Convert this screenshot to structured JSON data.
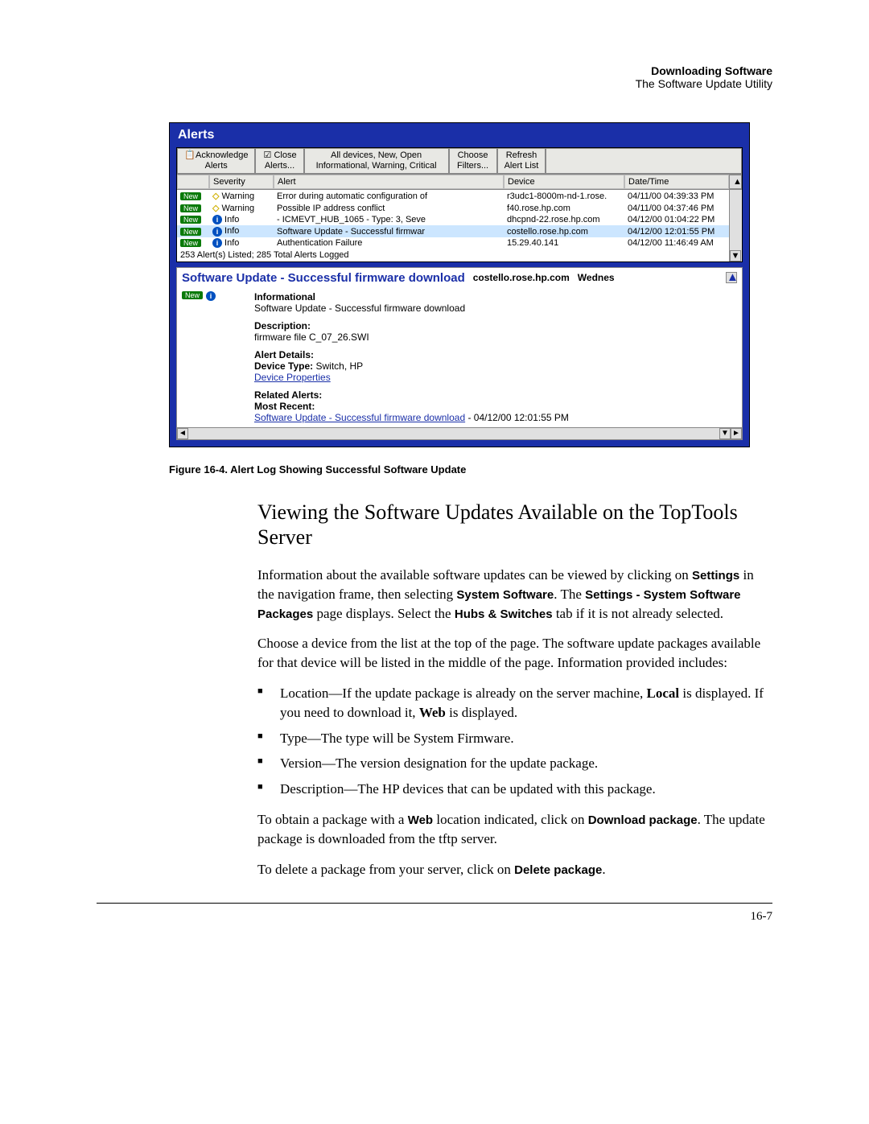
{
  "header": {
    "title_bold": "Downloading Software",
    "subtitle": "The Software Update Utility"
  },
  "window": {
    "title": "Alerts",
    "toolbar": {
      "ack": "Acknowledge",
      "ack2": "Alerts",
      "close": "Close",
      "close2": "Alerts...",
      "filter_line1": "All devices, New, Open",
      "filter_line2": "Informational, Warning, Critical",
      "choose": "Choose",
      "choose2": "Filters...",
      "refresh": "Refresh",
      "refresh2": "Alert List"
    },
    "columns": {
      "severity": "Severity",
      "alert": "Alert",
      "device": "Device",
      "date": "Date/Time"
    },
    "rows": [
      {
        "new": "New",
        "sev_type": "warn",
        "sev": "Warning",
        "alert": "Error during automatic configuration of",
        "device": "r3udc1-8000m-nd-1.rose.",
        "date": "04/11/00 04:39:33 PM"
      },
      {
        "new": "New",
        "sev_type": "warn",
        "sev": "Warning",
        "alert": "Possible IP address conflict",
        "device": "f40.rose.hp.com",
        "date": "04/11/00 04:37:46 PM"
      },
      {
        "new": "New",
        "sev_type": "info",
        "sev": "Info",
        "alert": "- ICMEVT_HUB_1065 - Type: 3, Seve",
        "device": "dhcpnd-22.rose.hp.com",
        "date": "04/12/00 01:04:22 PM"
      },
      {
        "new": "New",
        "sev_type": "info",
        "sev": "Info",
        "alert": "Software Update - Successful firmwar",
        "device": "costello.rose.hp.com",
        "date": "04/12/00 12:01:55 PM",
        "selected": true
      },
      {
        "new": "New",
        "sev_type": "info",
        "sev": "Info",
        "alert": "Authentication Failure",
        "device": "15.29.40.141",
        "date": "04/12/00 11:46:49 AM"
      }
    ],
    "status": "253 Alert(s) Listed; 285 Total Alerts Logged",
    "detail": {
      "title": "Software Update - Successful firmware download",
      "host": "costello.rose.hp.com",
      "day": "Wednes",
      "badge": "New",
      "level": "Informational",
      "summary": "Software Update - Successful firmware download",
      "desc_label": "Description:",
      "desc_text": "firmware file C_07_26.SWI",
      "details_label": "Alert Details:",
      "device_type_label": "Device Type:",
      "device_type_value": " Switch, HP",
      "device_props_link": "Device Properties",
      "related_label": "Related Alerts:",
      "most_recent_label": "Most Recent:",
      "recent_link": "Software Update - Successful firmware download",
      "recent_suffix": " - 04/12/00 12:01:55 PM"
    }
  },
  "figure_caption": "Figure 16-4. Alert Log Showing Successful Software Update",
  "heading": "Viewing the Software Updates Available on the TopTools Server",
  "para1_pre": "Information about the available software updates can be viewed by clicking on ",
  "para1_b1": "Settings",
  "para1_mid1": " in the navigation frame, then selecting ",
  "para1_b2": "System Software",
  "para1_mid2": ". The ",
  "para1_b3": "Settings - System Software Packages",
  "para1_mid3": " page displays. Select the ",
  "para1_b4": "Hubs & Switches",
  "para1_end": " tab if it is not already selected.",
  "para2": "Choose a device from the list at the top of the page. The software update packages available for that device will be listed in the middle of the page. Information provided includes:",
  "bullets": {
    "b1_pre": "Location—If the update package is already on the server machine, ",
    "b1_b1": "Local",
    "b1_mid": " is displayed. If you need to download it, ",
    "b1_b2": "Web",
    "b1_end": " is displayed.",
    "b2": "Type—The type will be System Firmware.",
    "b3": "Version—The version designation for the update package.",
    "b4": "Description—The HP devices that can be updated with this package."
  },
  "para3_pre": "To obtain a package with a ",
  "para3_b1": "Web",
  "para3_mid": " location indicated, click on ",
  "para3_b2": "Download package",
  "para3_end": ". The update package is downloaded from the tftp server.",
  "para4_pre": "To delete a package from your server, click on ",
  "para4_b1": "Delete package",
  "para4_end": ".",
  "page_number": "16-7"
}
